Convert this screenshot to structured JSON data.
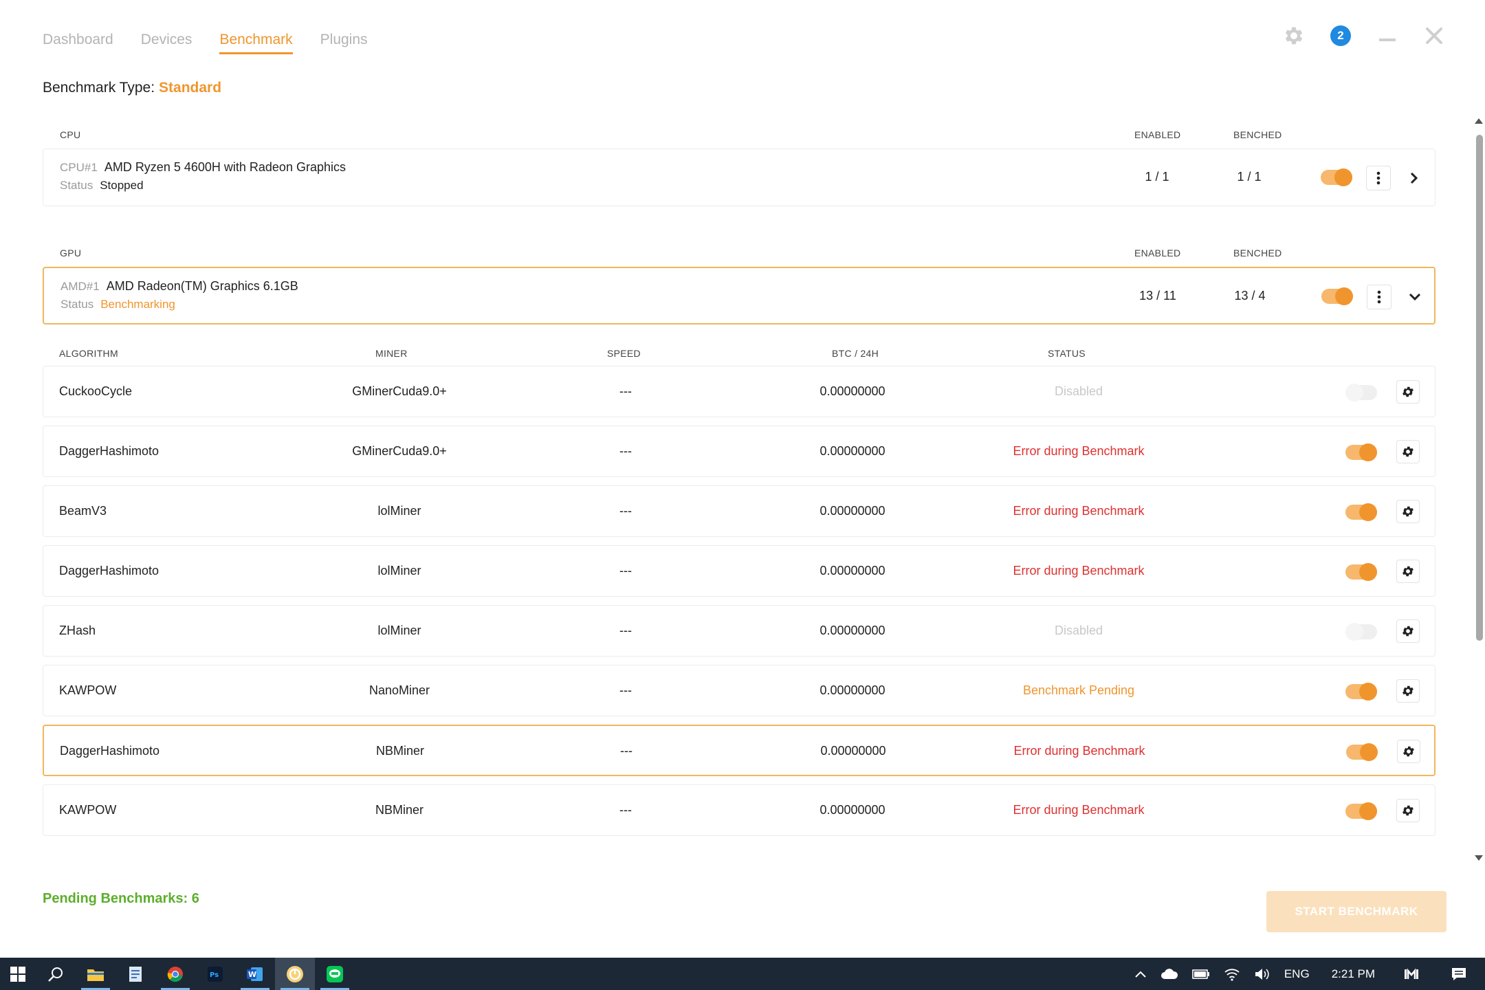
{
  "tabs": [
    {
      "label": "Dashboard",
      "active": false
    },
    {
      "label": "Devices",
      "active": false
    },
    {
      "label": "Benchmark",
      "active": true
    },
    {
      "label": "Plugins",
      "active": false
    }
  ],
  "window_controls": {
    "notification_count": "2"
  },
  "benchmark_type": {
    "label": "Benchmark Type:",
    "value": "Standard"
  },
  "cpu_section": {
    "label": "CPU",
    "col_enabled": "ENABLED",
    "col_benched": "BENCHED",
    "device": {
      "id": "CPU#1",
      "name": "AMD Ryzen 5 4600H with Radeon Graphics",
      "status_label": "Status",
      "status": "Stopped",
      "enabled": "1 / 1",
      "benched": "1 / 1"
    }
  },
  "gpu_section": {
    "label": "GPU",
    "col_enabled": "ENABLED",
    "col_benched": "BENCHED",
    "device": {
      "id": "AMD#1",
      "name": "AMD Radeon(TM) Graphics 6.1GB",
      "status_label": "Status",
      "status": "Benchmarking",
      "enabled": "13 / 11",
      "benched": "13 / 4"
    }
  },
  "algo_columns": {
    "algorithm": "ALGORITHM",
    "miner": "MINER",
    "speed": "SPEED",
    "btc": "BTC / 24H",
    "status": "STATUS"
  },
  "algorithms": [
    {
      "algorithm": "CuckooCycle",
      "miner": "GMinerCuda9.0+",
      "speed": "---",
      "btc": "0.00000000",
      "status": "Disabled",
      "status_kind": "disabled",
      "enabled": false
    },
    {
      "algorithm": "DaggerHashimoto",
      "miner": "GMinerCuda9.0+",
      "speed": "---",
      "btc": "0.00000000",
      "status": "Error during Benchmark",
      "status_kind": "error",
      "enabled": true
    },
    {
      "algorithm": "BeamV3",
      "miner": "lolMiner",
      "speed": "---",
      "btc": "0.00000000",
      "status": "Error during Benchmark",
      "status_kind": "error",
      "enabled": true
    },
    {
      "algorithm": "DaggerHashimoto",
      "miner": "lolMiner",
      "speed": "---",
      "btc": "0.00000000",
      "status": "Error during Benchmark",
      "status_kind": "error",
      "enabled": true
    },
    {
      "algorithm": "ZHash",
      "miner": "lolMiner",
      "speed": "---",
      "btc": "0.00000000",
      "status": "Disabled",
      "status_kind": "disabled",
      "enabled": false
    },
    {
      "algorithm": "KAWPOW",
      "miner": "NanoMiner",
      "speed": "---",
      "btc": "0.00000000",
      "status": "Benchmark Pending",
      "status_kind": "pending",
      "enabled": true
    },
    {
      "algorithm": "DaggerHashimoto",
      "miner": "NBMiner",
      "speed": "---",
      "btc": "0.00000000",
      "status": "Error during Benchmark",
      "status_kind": "error",
      "enabled": true,
      "selected": true
    },
    {
      "algorithm": "KAWPOW",
      "miner": "NBMiner",
      "speed": "---",
      "btc": "0.00000000",
      "status": "Error during Benchmark",
      "status_kind": "error",
      "enabled": true
    }
  ],
  "footer": {
    "pending": "Pending Benchmarks: 6",
    "start_button": "START BENCHMARK"
  },
  "taskbar": {
    "language": "ENG",
    "time": "2:21 PM"
  },
  "colors": {
    "accent": "#f0952d",
    "error": "#e02f2f",
    "success": "#5cae2c",
    "badge": "#2089e0"
  }
}
